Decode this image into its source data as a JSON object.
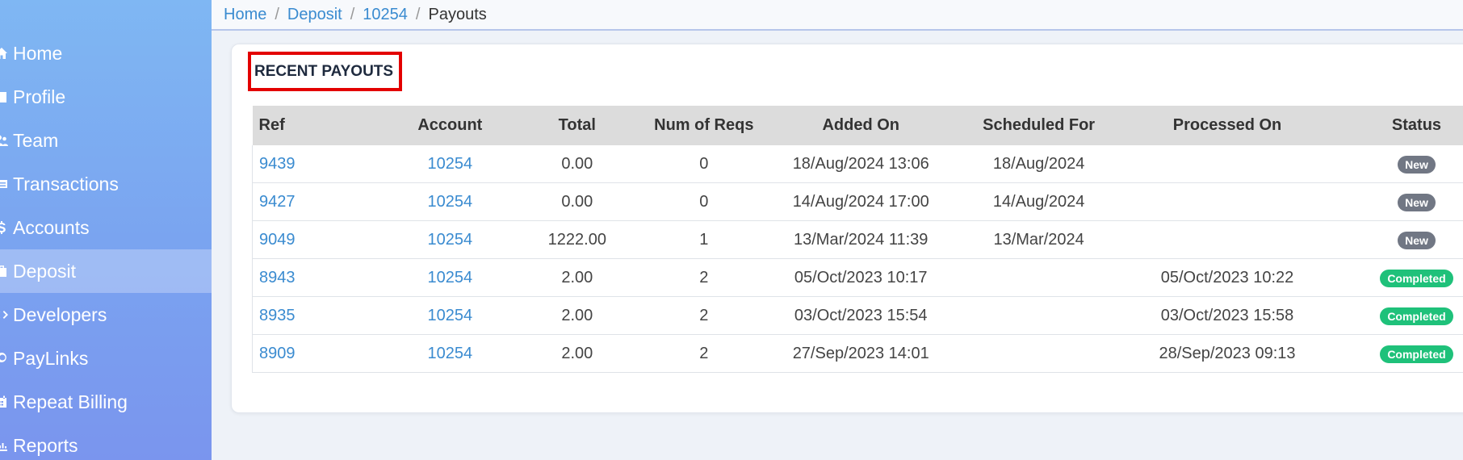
{
  "sidebar": {
    "items": [
      {
        "label": "Home",
        "icon": "home-icon",
        "active": false
      },
      {
        "label": "Profile",
        "icon": "profile-icon",
        "active": false
      },
      {
        "label": "Team",
        "icon": "team-icon",
        "active": false
      },
      {
        "label": "Transactions",
        "icon": "transactions-icon",
        "active": false
      },
      {
        "label": "Accounts",
        "icon": "dollar-icon",
        "active": false
      },
      {
        "label": "Deposit",
        "icon": "deposit-icon",
        "active": true
      },
      {
        "label": "Developers",
        "icon": "code-icon",
        "active": false
      },
      {
        "label": "PayLinks",
        "icon": "paylink-icon",
        "active": false
      },
      {
        "label": "Repeat Billing",
        "icon": "calendar-icon",
        "active": false
      },
      {
        "label": "Reports",
        "icon": "reports-icon",
        "active": false
      }
    ]
  },
  "breadcrumb": {
    "home": "Home",
    "deposit": "Deposit",
    "account": "10254",
    "current": "Payouts",
    "separator": "/"
  },
  "card": {
    "title": "RECENT PAYOUTS"
  },
  "table": {
    "headers": [
      "Ref",
      "Account",
      "Total",
      "Num of Reqs",
      "Added On",
      "Scheduled For",
      "Processed On",
      "Status"
    ],
    "rows": [
      {
        "ref": "9439",
        "account": "10254",
        "total": "0.00",
        "reqs": "0",
        "added": "18/Aug/2024 13:06",
        "scheduled": "18/Aug/2024",
        "processed": "",
        "status": "New"
      },
      {
        "ref": "9427",
        "account": "10254",
        "total": "0.00",
        "reqs": "0",
        "added": "14/Aug/2024 17:00",
        "scheduled": "14/Aug/2024",
        "processed": "",
        "status": "New"
      },
      {
        "ref": "9049",
        "account": "10254",
        "total": "1222.00",
        "reqs": "1",
        "added": "13/Mar/2024 11:39",
        "scheduled": "13/Mar/2024",
        "processed": "",
        "status": "New"
      },
      {
        "ref": "8943",
        "account": "10254",
        "total": "2.00",
        "reqs": "2",
        "added": "05/Oct/2023 10:17",
        "scheduled": "",
        "processed": "05/Oct/2023 10:22",
        "status": "Completed"
      },
      {
        "ref": "8935",
        "account": "10254",
        "total": "2.00",
        "reqs": "2",
        "added": "03/Oct/2023 15:54",
        "scheduled": "",
        "processed": "03/Oct/2023 15:58",
        "status": "Completed"
      },
      {
        "ref": "8909",
        "account": "10254",
        "total": "2.00",
        "reqs": "2",
        "added": "27/Sep/2023 14:01",
        "scheduled": "",
        "processed": "28/Sep/2023 09:13",
        "status": "Completed"
      }
    ]
  },
  "colors": {
    "link": "#3a8bd0",
    "badge_new": "#717784",
    "badge_completed": "#1fc17a",
    "highlight_box": "#e30000"
  }
}
